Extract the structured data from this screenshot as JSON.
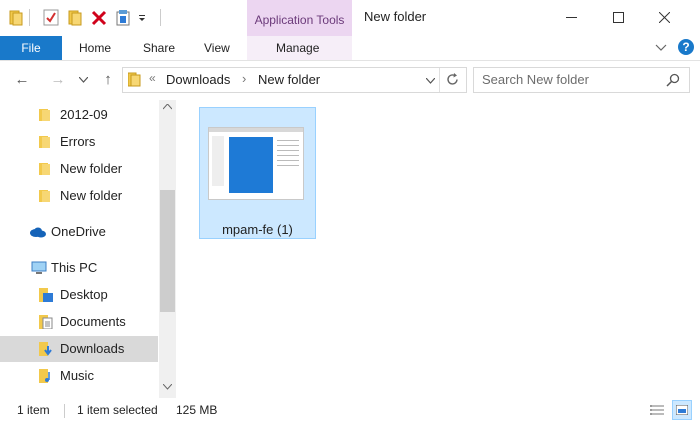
{
  "window": {
    "title": "New folder",
    "context_tab": "Application Tools",
    "controls": [
      "minimize",
      "maximize",
      "close"
    ]
  },
  "ribbon": {
    "tabs": [
      "File",
      "Home",
      "Share",
      "View",
      "Manage"
    ],
    "accent": "#1979ca",
    "context_color": "#ecd6f1"
  },
  "address": {
    "breadcrumb": [
      "Downloads",
      "New folder"
    ]
  },
  "search": {
    "placeholder": "Search New folder"
  },
  "nav": {
    "items": [
      {
        "label": "2012-09",
        "type": "folder"
      },
      {
        "label": "Errors",
        "type": "folder"
      },
      {
        "label": "New folder",
        "type": "folder"
      },
      {
        "label": "New folder",
        "type": "folder"
      },
      {
        "label": "OneDrive",
        "type": "onedrive"
      },
      {
        "label": "This PC",
        "type": "pc"
      },
      {
        "label": "Desktop",
        "type": "desktop"
      },
      {
        "label": "Documents",
        "type": "documents"
      },
      {
        "label": "Downloads",
        "type": "downloads",
        "selected": true
      },
      {
        "label": "Music",
        "type": "music"
      }
    ]
  },
  "content": {
    "files": [
      {
        "name": "mpam-fe (1)",
        "selected": true
      }
    ]
  },
  "status": {
    "item_count": "1 item",
    "selected": "1 item selected",
    "size": "125 MB"
  }
}
